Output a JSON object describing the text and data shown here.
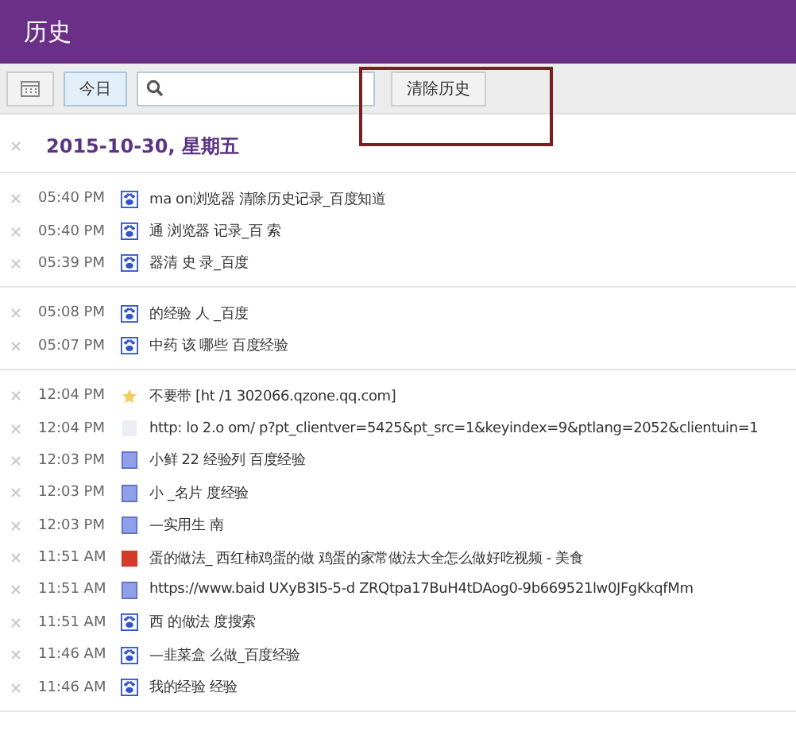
{
  "header": {
    "title": "历史"
  },
  "toolbar": {
    "today_button": "今日",
    "clear_button": "清除历史"
  },
  "date_heading": "2015-10-30, 星期五",
  "groups": [
    {
      "entries": [
        {
          "time": "05:40 PM",
          "kind": "paw",
          "title": "ma     on浏览器       清除历史记录_百度知道"
        },
        {
          "time": "05:40 PM",
          "kind": "paw",
          "title": "通     浏览器     记录_百      索"
        },
        {
          "time": "05:39 PM",
          "kind": "paw",
          "title": "      器清     史    录_百度"
        }
      ]
    },
    {
      "entries": [
        {
          "time": "05:08 PM",
          "kind": "paw",
          "title": "      的经验     人      _百度"
        },
        {
          "time": "05:07 PM",
          "kind": "paw",
          "title": "      中药      该     哪些       百度经验"
        }
      ]
    },
    {
      "entries": [
        {
          "time": "12:04 PM",
          "kind": "star",
          "title": "不要带       [ht     /1      302066.qzone.qq.com]"
        },
        {
          "time": "12:04 PM",
          "kind": "blank",
          "title": "http:     lo     2.o     om/     p?pt_clientver=5425&pt_src=1&keyindex=9&ptlang=2052&clientuin=1"
        },
        {
          "time": "12:03 PM",
          "kind": "page",
          "title": "小鲜     22      经验列      百度经验"
        },
        {
          "time": "12:03 PM",
          "kind": "page",
          "title": "小          _名片      度经验"
        },
        {
          "time": "12:03 PM",
          "kind": "page",
          "title": "        —实用生     南"
        },
        {
          "time": "11:51 AM",
          "kind": "red",
          "title": "      蛋的做法_      西红柿鸡蛋的做           鸡蛋的家常做法大全怎么做好吃视频 - 美食"
        },
        {
          "time": "11:51 AM",
          "kind": "page",
          "title": "https://www.baid          UXyB3I5-5-d      ZRQtpa17BuH4tDAog0-9b669521lw0JFgKkqfMm"
        },
        {
          "time": "11:51 AM",
          "kind": "paw",
          "title": "西       的做法     度搜索"
        },
        {
          "time": "11:46 AM",
          "kind": "paw",
          "title": "          —韭菜盒       么做_百度经验"
        },
        {
          "time": "11:46 AM",
          "kind": "paw",
          "title": "我的经验              经验"
        }
      ]
    }
  ]
}
